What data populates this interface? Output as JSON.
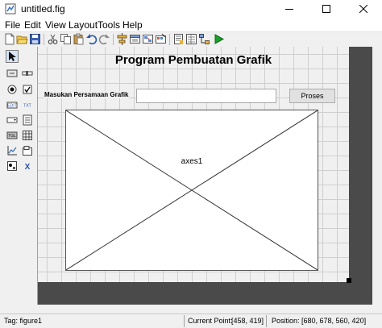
{
  "window": {
    "title": "untitled.fig"
  },
  "menu": [
    {
      "label": "File"
    },
    {
      "label": "Edit"
    },
    {
      "label": "View"
    },
    {
      "label": "Layout"
    },
    {
      "label": "Tools"
    },
    {
      "label": "Help"
    }
  ],
  "toolbar": {
    "icons": [
      "new-file-icon",
      "open-folder-icon",
      "save-icon",
      "cut-icon",
      "copy-icon",
      "paste-icon",
      "undo-icon",
      "redo-icon",
      "align-objects-icon",
      "menu-editor-icon",
      "tab-order-icon",
      "toolbar-editor-icon",
      "editor-icon",
      "property-inspector-icon",
      "object-browser-icon",
      "run-icon"
    ]
  },
  "palette": {
    "items": [
      "select-pointer",
      "push-button",
      "slider",
      "radio-button",
      "check-box",
      "edit-text",
      "static-text",
      "popup-menu",
      "listbox",
      "toggle-button",
      "table",
      "axes",
      "panel",
      "button-group",
      "activex-control"
    ]
  },
  "figure": {
    "title": "Program Pembuatan Grafik",
    "input_label": "Masukan Persamaan Grafik",
    "input_value": "",
    "button_label": "Proses",
    "axes_label": "axes1"
  },
  "status": {
    "tag": "Tag: figure1",
    "current_point_label": "Current Point:",
    "current_point_value": "[458, 419]",
    "position_label": "Position:",
    "position_value": "[680, 678, 560, 420]"
  },
  "colors": {
    "run_green": "#1a9f2a",
    "dark_area": "#4a4a4a",
    "selected_tool_bg": "#d8e6f5"
  }
}
